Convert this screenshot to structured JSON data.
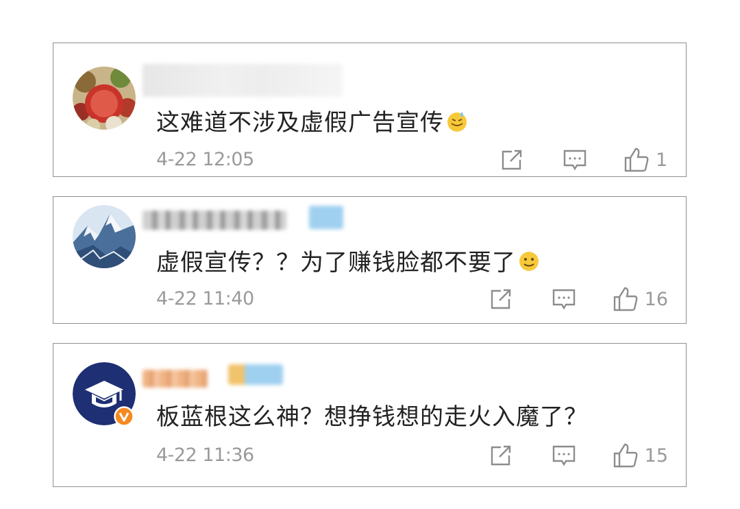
{
  "comments": [
    {
      "text": "这难道不涉及虚假广告宣传",
      "emoji": "sweat-smile-emoji",
      "timestamp": "4-22 12:05",
      "likes": "1"
    },
    {
      "text": "虚假宣传？？为了赚钱脸都不要了",
      "emoji": "smile-emoji",
      "timestamp": "4-22 11:40",
      "likes": "16"
    },
    {
      "text": "板蓝根这么神？想挣钱想的走火入魔了？",
      "emoji": "",
      "timestamp": "4-22 11:36",
      "likes": "15"
    }
  ],
  "icons": {
    "share": "share-icon",
    "reply": "comment-icon",
    "like": "thumbs-up-icon",
    "verified": "verified-v-badge-icon"
  },
  "colors": {
    "text": "#222222",
    "meta": "#9a9a9a",
    "icon": "#8c8c8c",
    "border": "#8e8e8e",
    "verified_badge": "#f5891f",
    "avatar_navy": "#1e2f73"
  }
}
